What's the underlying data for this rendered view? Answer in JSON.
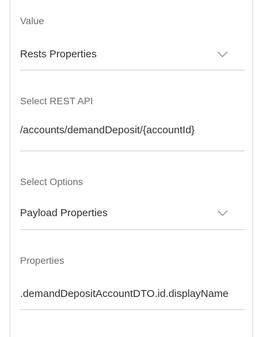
{
  "fields": [
    {
      "label": "Value",
      "value": "Rests Properties"
    },
    {
      "label": "Select REST API",
      "value": "/accounts/demandDeposit/{accountId}"
    },
    {
      "label": "Select Options",
      "value": "Payload Properties"
    },
    {
      "label": "Properties",
      "value": ".demandDepositAccountDTO.id.displayName"
    }
  ],
  "colors": {
    "label": "#6b6b6b",
    "value": "#2f2f2f",
    "underline": "#d0d0d0",
    "chevron": "#9a9a9a",
    "border": "#d9d9d9"
  },
  "icons": {
    "dropdown": "chevron-down-icon"
  }
}
